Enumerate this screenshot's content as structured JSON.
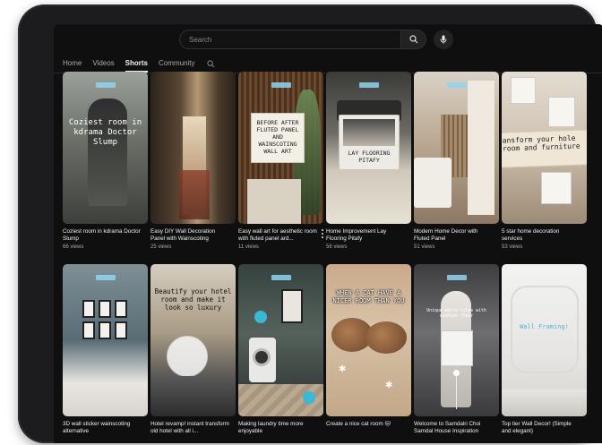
{
  "search": {
    "placeholder": "Search"
  },
  "tabs": [
    {
      "label": "Home",
      "active": false
    },
    {
      "label": "Videos",
      "active": false
    },
    {
      "label": "Shorts",
      "active": true
    },
    {
      "label": "Community",
      "active": false
    }
  ],
  "icons": {
    "search": "search-icon",
    "mic": "microphone-icon",
    "more": "more-vertical-icon"
  },
  "colors": {
    "background": "#0f0f0f",
    "text_primary": "#f1f1f1",
    "text_secondary": "#aaaaaa"
  },
  "shorts": [
    {
      "title": "Coziest room in kdrama Doctor Slump",
      "views": "66 views",
      "overlay": "Coziest room in kdrama Doctor Slump"
    },
    {
      "title": "Easy DIY Wall Decoration Panel with Wainscoting",
      "views": "25 views",
      "overlay": ""
    },
    {
      "title": "Easy wall art for aesthetic room with fluted panel ard...",
      "views": "11 views",
      "overlay": "BEFORE AFTER FLUTED PANEL AND WAINSCOTING WALL ART"
    },
    {
      "title": "Home Improvement Lay Flooring Pitafy",
      "views": "56 views",
      "overlay": "LAY FLOORING PITAFY"
    },
    {
      "title": "Modern Home Decor with Fluted Panel",
      "views": "51 views",
      "overlay": ""
    },
    {
      "title": "5 star home decoration services",
      "views": "53 views",
      "overlay": "ansform your hole room and furniture"
    },
    {
      "title": "3D wall sticker wainscoting alternative",
      "views": "",
      "overlay": ""
    },
    {
      "title": "Hotel revamp! instant transform old hotel with all i...",
      "views": "",
      "overlay": "Beautify your hotel room and make it look so luxury"
    },
    {
      "title": "Making laundry time more enjoyable",
      "views": "",
      "overlay": ""
    },
    {
      "title": "Create a nice cat room 🐱",
      "views": "",
      "overlay": "WHEN A CAT HAVE A NICER ROOM THAN YOU"
    },
    {
      "title": "Welcome to Samdalri Choi Samdal House Inspiration",
      "views": "",
      "overlay": "Unique white tiles with cushion floor"
    },
    {
      "title": "Top tier Wall Decor! (Simple and elegant)",
      "views": "",
      "overlay": "Wall Framing!"
    }
  ]
}
